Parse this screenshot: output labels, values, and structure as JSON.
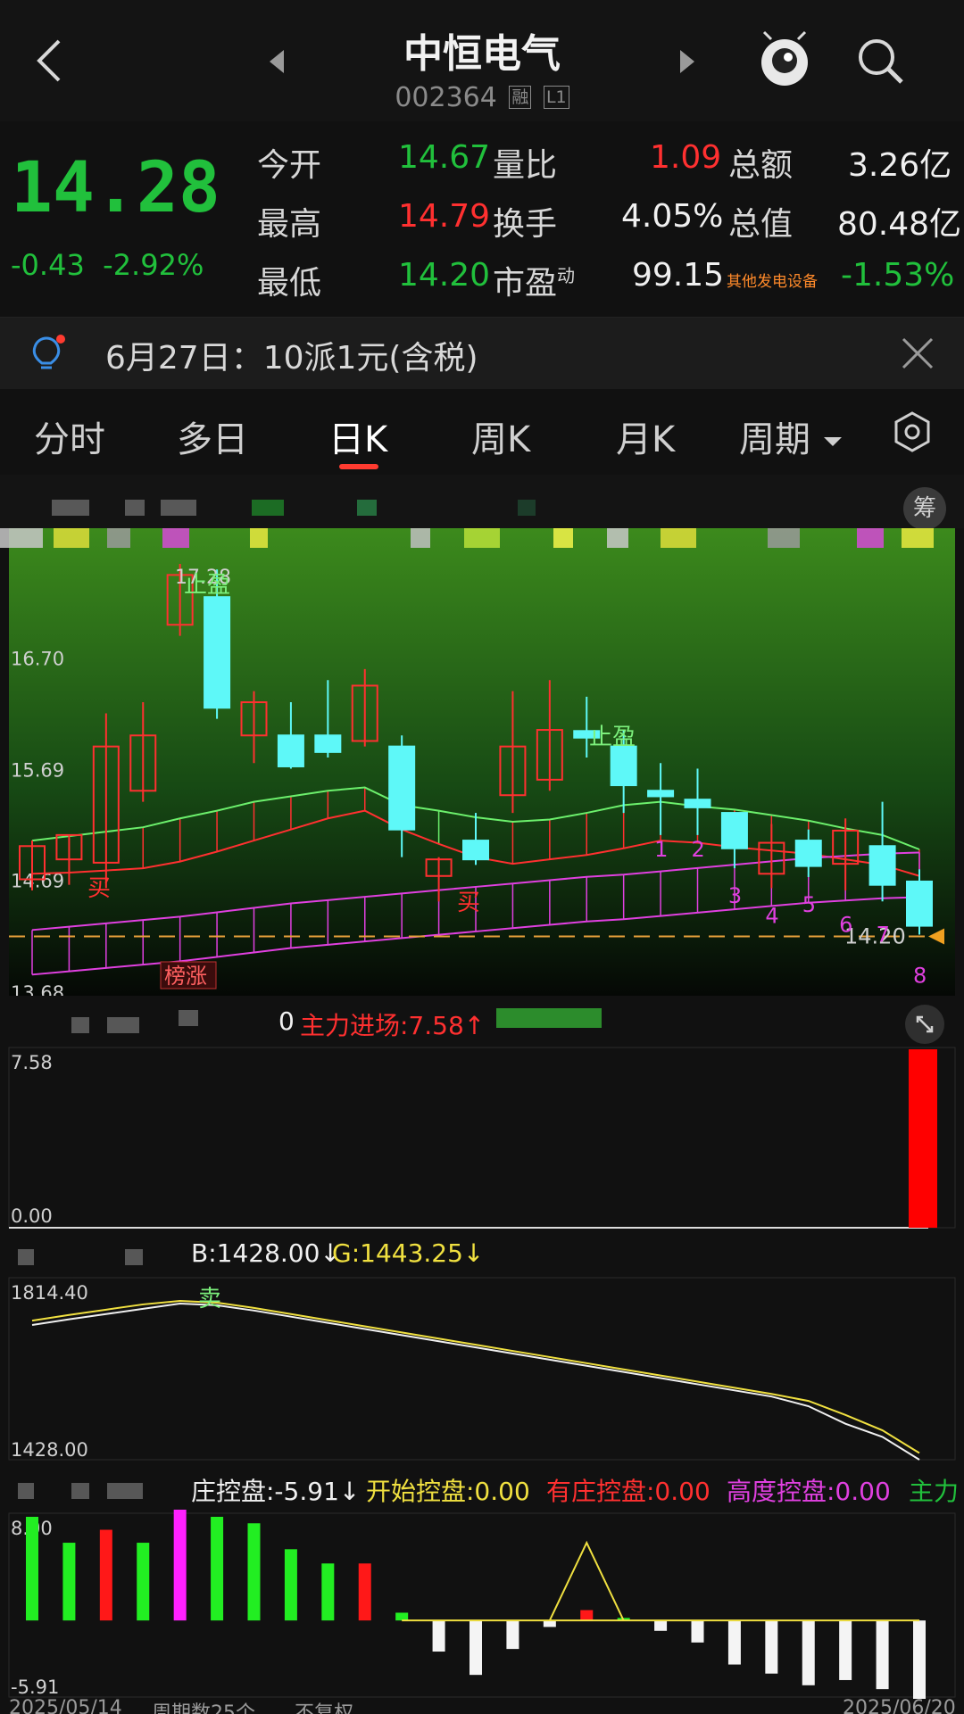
{
  "header": {
    "title": "中恒电气",
    "code": "002364",
    "tag_margin": "融",
    "tag_level": "L1"
  },
  "quote": {
    "price": "14.28",
    "change": "-0.43",
    "change_pct": "-2.92%",
    "open_label": "今开",
    "open": "14.67",
    "high_label": "最高",
    "high": "14.79",
    "low_label": "最低",
    "low": "14.20",
    "vol_ratio_label": "量比",
    "vol_ratio": "1.09",
    "turnover_label": "换手",
    "turnover": "4.05%",
    "pe_label": "市盈",
    "pe_sup": "动",
    "pe": "99.15",
    "amount_label": "总额",
    "amount": "3.26亿",
    "cap_label": "总值",
    "cap": "80.48亿",
    "sector": "其他发电设备",
    "sector_pct": "-1.53%"
  },
  "notice": {
    "text": "6月27日：10派1元(含税)"
  },
  "tabs": [
    {
      "label": "分时"
    },
    {
      "label": "多日"
    },
    {
      "label": "日K"
    },
    {
      "label": "周K"
    },
    {
      "label": "月K"
    },
    {
      "label": "周期"
    }
  ],
  "colors": {
    "up": "#ff3030",
    "down": "#21c03c",
    "cyan": "#5ef8f8",
    "magenta": "#e040e0",
    "yellow": "#f0e040"
  },
  "kline": {
    "chip_button": "筹",
    "y_ticks": [
      "16.70",
      "15.69",
      "14.69",
      "13.68"
    ],
    "y_tick_values": [
      16.7,
      15.69,
      14.69,
      13.68
    ],
    "y_range": [
      13.68,
      17.55
    ],
    "top_price": "17.28",
    "last_price": "14.20",
    "badge": "榜涨",
    "labels": {
      "take_profit": "止盈",
      "buy": "买"
    },
    "seq_numbers": [
      "1",
      "2",
      "3",
      "4",
      "5",
      "6",
      "7",
      "8"
    ],
    "candles": [
      {
        "o": 14.7,
        "c": 15.0,
        "h": 15.05,
        "l": 14.6
      },
      {
        "o": 14.88,
        "c": 15.1,
        "h": 15.1,
        "l": 14.65
      },
      {
        "o": 14.85,
        "c": 15.9,
        "h": 16.2,
        "l": 14.62
      },
      {
        "o": 15.5,
        "c": 16.0,
        "h": 16.3,
        "l": 15.4
      },
      {
        "o": 17.0,
        "c": 17.45,
        "h": 17.55,
        "l": 16.9
      },
      {
        "o": 17.25,
        "c": 16.25,
        "h": 17.5,
        "l": 16.15
      },
      {
        "o": 16.0,
        "c": 16.3,
        "h": 16.4,
        "l": 15.75
      },
      {
        "o": 16.0,
        "c": 15.72,
        "h": 16.3,
        "l": 15.7
      },
      {
        "o": 16.0,
        "c": 15.85,
        "h": 16.5,
        "l": 15.8
      },
      {
        "o": 15.95,
        "c": 16.45,
        "h": 16.6,
        "l": 15.9
      },
      {
        "o": 15.9,
        "c": 15.15,
        "h": 16.0,
        "l": 14.9
      },
      {
        "o": 14.73,
        "c": 14.88,
        "h": 14.9,
        "l": 14.5
      },
      {
        "o": 15.05,
        "c": 14.88,
        "h": 15.3,
        "l": 14.83
      },
      {
        "o": 15.46,
        "c": 15.9,
        "h": 16.4,
        "l": 15.3
      },
      {
        "o": 15.6,
        "c": 16.05,
        "h": 16.5,
        "l": 15.5
      },
      {
        "o": 16.04,
        "c": 15.98,
        "h": 16.35,
        "l": 15.8
      },
      {
        "o": 15.9,
        "c": 15.55,
        "h": 16.05,
        "l": 15.3
      },
      {
        "o": 15.5,
        "c": 15.45,
        "h": 15.75,
        "l": 15.1
      },
      {
        "o": 15.42,
        "c": 15.35,
        "h": 15.7,
        "l": 15.1
      },
      {
        "o": 15.3,
        "c": 14.98,
        "h": 15.3,
        "l": 14.8
      },
      {
        "o": 14.75,
        "c": 15.03,
        "h": 15.2,
        "l": 14.62
      },
      {
        "o": 15.05,
        "c": 14.82,
        "h": 15.15,
        "l": 14.72
      },
      {
        "o": 14.84,
        "c": 15.14,
        "h": 15.25,
        "l": 14.6
      },
      {
        "o": 15.0,
        "c": 14.65,
        "h": 15.4,
        "l": 14.5
      },
      {
        "o": 14.68,
        "c": 14.28,
        "h": 14.79,
        "l": 14.2
      }
    ],
    "upper_band": [
      15.05,
      15.09,
      15.13,
      15.17,
      15.25,
      15.32,
      15.4,
      15.45,
      15.5,
      15.53,
      15.37,
      15.32,
      15.26,
      15.22,
      15.24,
      15.3,
      15.37,
      15.4,
      15.36,
      15.33,
      15.28,
      15.23,
      15.16,
      15.1,
      14.97
    ],
    "mid_band": [
      14.75,
      14.76,
      14.78,
      14.8,
      14.86,
      14.95,
      15.05,
      15.15,
      15.25,
      15.32,
      15.15,
      15.02,
      14.9,
      14.84,
      14.88,
      14.92,
      14.98,
      15.05,
      15.03,
      14.99,
      14.96,
      14.93,
      14.88,
      14.83,
      14.73
    ],
    "lower_band": [
      14.0,
      14.03,
      14.06,
      14.09,
      14.12,
      14.16,
      14.2,
      14.24,
      14.27,
      14.3,
      14.33,
      14.36,
      14.39,
      14.42,
      14.45,
      14.48,
      14.5,
      14.53,
      14.56,
      14.59,
      14.62,
      14.65,
      14.67,
      14.69,
      14.7
    ]
  },
  "pane1": {
    "header": "主力进场:7.58↑",
    "prefix": "0",
    "y_top": "7.58",
    "y_bottom": "0.00",
    "bar_value": 7.58
  },
  "pane2": {
    "b_text": "B:1428.00↓",
    "g_text": "G:1443.25↓",
    "y_top": "1814.40",
    "y_bottom": "1428.00",
    "sell_label": "卖",
    "line_b": [
      1735,
      1748,
      1760,
      1772,
      1784,
      1780,
      1768,
      1754,
      1740,
      1726,
      1712,
      1698,
      1684,
      1670,
      1656,
      1642,
      1628,
      1614,
      1600,
      1586,
      1572,
      1550,
      1510,
      1480,
      1428
    ],
    "line_g": [
      1745,
      1758,
      1770,
      1782,
      1790,
      1786,
      1774,
      1760,
      1746,
      1732,
      1718,
      1704,
      1690,
      1676,
      1662,
      1648,
      1634,
      1620,
      1606,
      1592,
      1578,
      1562,
      1530,
      1495,
      1443.25
    ]
  },
  "pane3": {
    "items": [
      {
        "text": "庄控盘:-5.91↓",
        "color": "#f0f0f0"
      },
      {
        "text": "开始控盘:0.00",
        "color": "#f0e040"
      },
      {
        "text": "有庄控盘:0.00",
        "color": "#ff3030"
      },
      {
        "text": "高度控盘:0.00",
        "color": "#e040e0"
      },
      {
        "text": "主力",
        "color": "#21c03c"
      }
    ],
    "y_top": "8.00",
    "y_bottom": "-5.91",
    "y_range": [
      -5.91,
      8.0
    ],
    "bars": [
      {
        "v": 8.0,
        "c": "g"
      },
      {
        "v": 6.0,
        "c": "g"
      },
      {
        "v": 7.0,
        "c": "r"
      },
      {
        "v": 6.0,
        "c": "g"
      },
      {
        "v": 9.5,
        "c": "m"
      },
      {
        "v": 8.0,
        "c": "g"
      },
      {
        "v": 7.5,
        "c": "g"
      },
      {
        "v": 5.5,
        "c": "g"
      },
      {
        "v": 4.4,
        "c": "g"
      },
      {
        "v": 4.4,
        "c": "r"
      },
      {
        "v": 0.6,
        "c": "g"
      },
      {
        "v": -2.4,
        "c": "w"
      },
      {
        "v": -4.2,
        "c": "w"
      },
      {
        "v": -2.2,
        "c": "w"
      },
      {
        "v": -0.5,
        "c": "w"
      },
      {
        "v": 0.8,
        "c": "r"
      },
      {
        "v": 0.2,
        "c": "g"
      },
      {
        "v": -0.8,
        "c": "w"
      },
      {
        "v": -1.7,
        "c": "w"
      },
      {
        "v": -3.4,
        "c": "w"
      },
      {
        "v": -4.1,
        "c": "w"
      },
      {
        "v": -5.0,
        "c": "w"
      },
      {
        "v": -4.6,
        "c": "w"
      },
      {
        "v": -5.3,
        "c": "w"
      },
      {
        "v": -7.2,
        "c": "w"
      }
    ],
    "peak": [
      {
        "i": 14,
        "v": 0
      },
      {
        "i": 15,
        "v": 6.0
      },
      {
        "i": 16,
        "v": 0
      }
    ]
  },
  "footer": {
    "left_date": "2025/05/14",
    "period": "周期数25个",
    "adjust": "不复权",
    "right_date": "2025/06/20"
  }
}
